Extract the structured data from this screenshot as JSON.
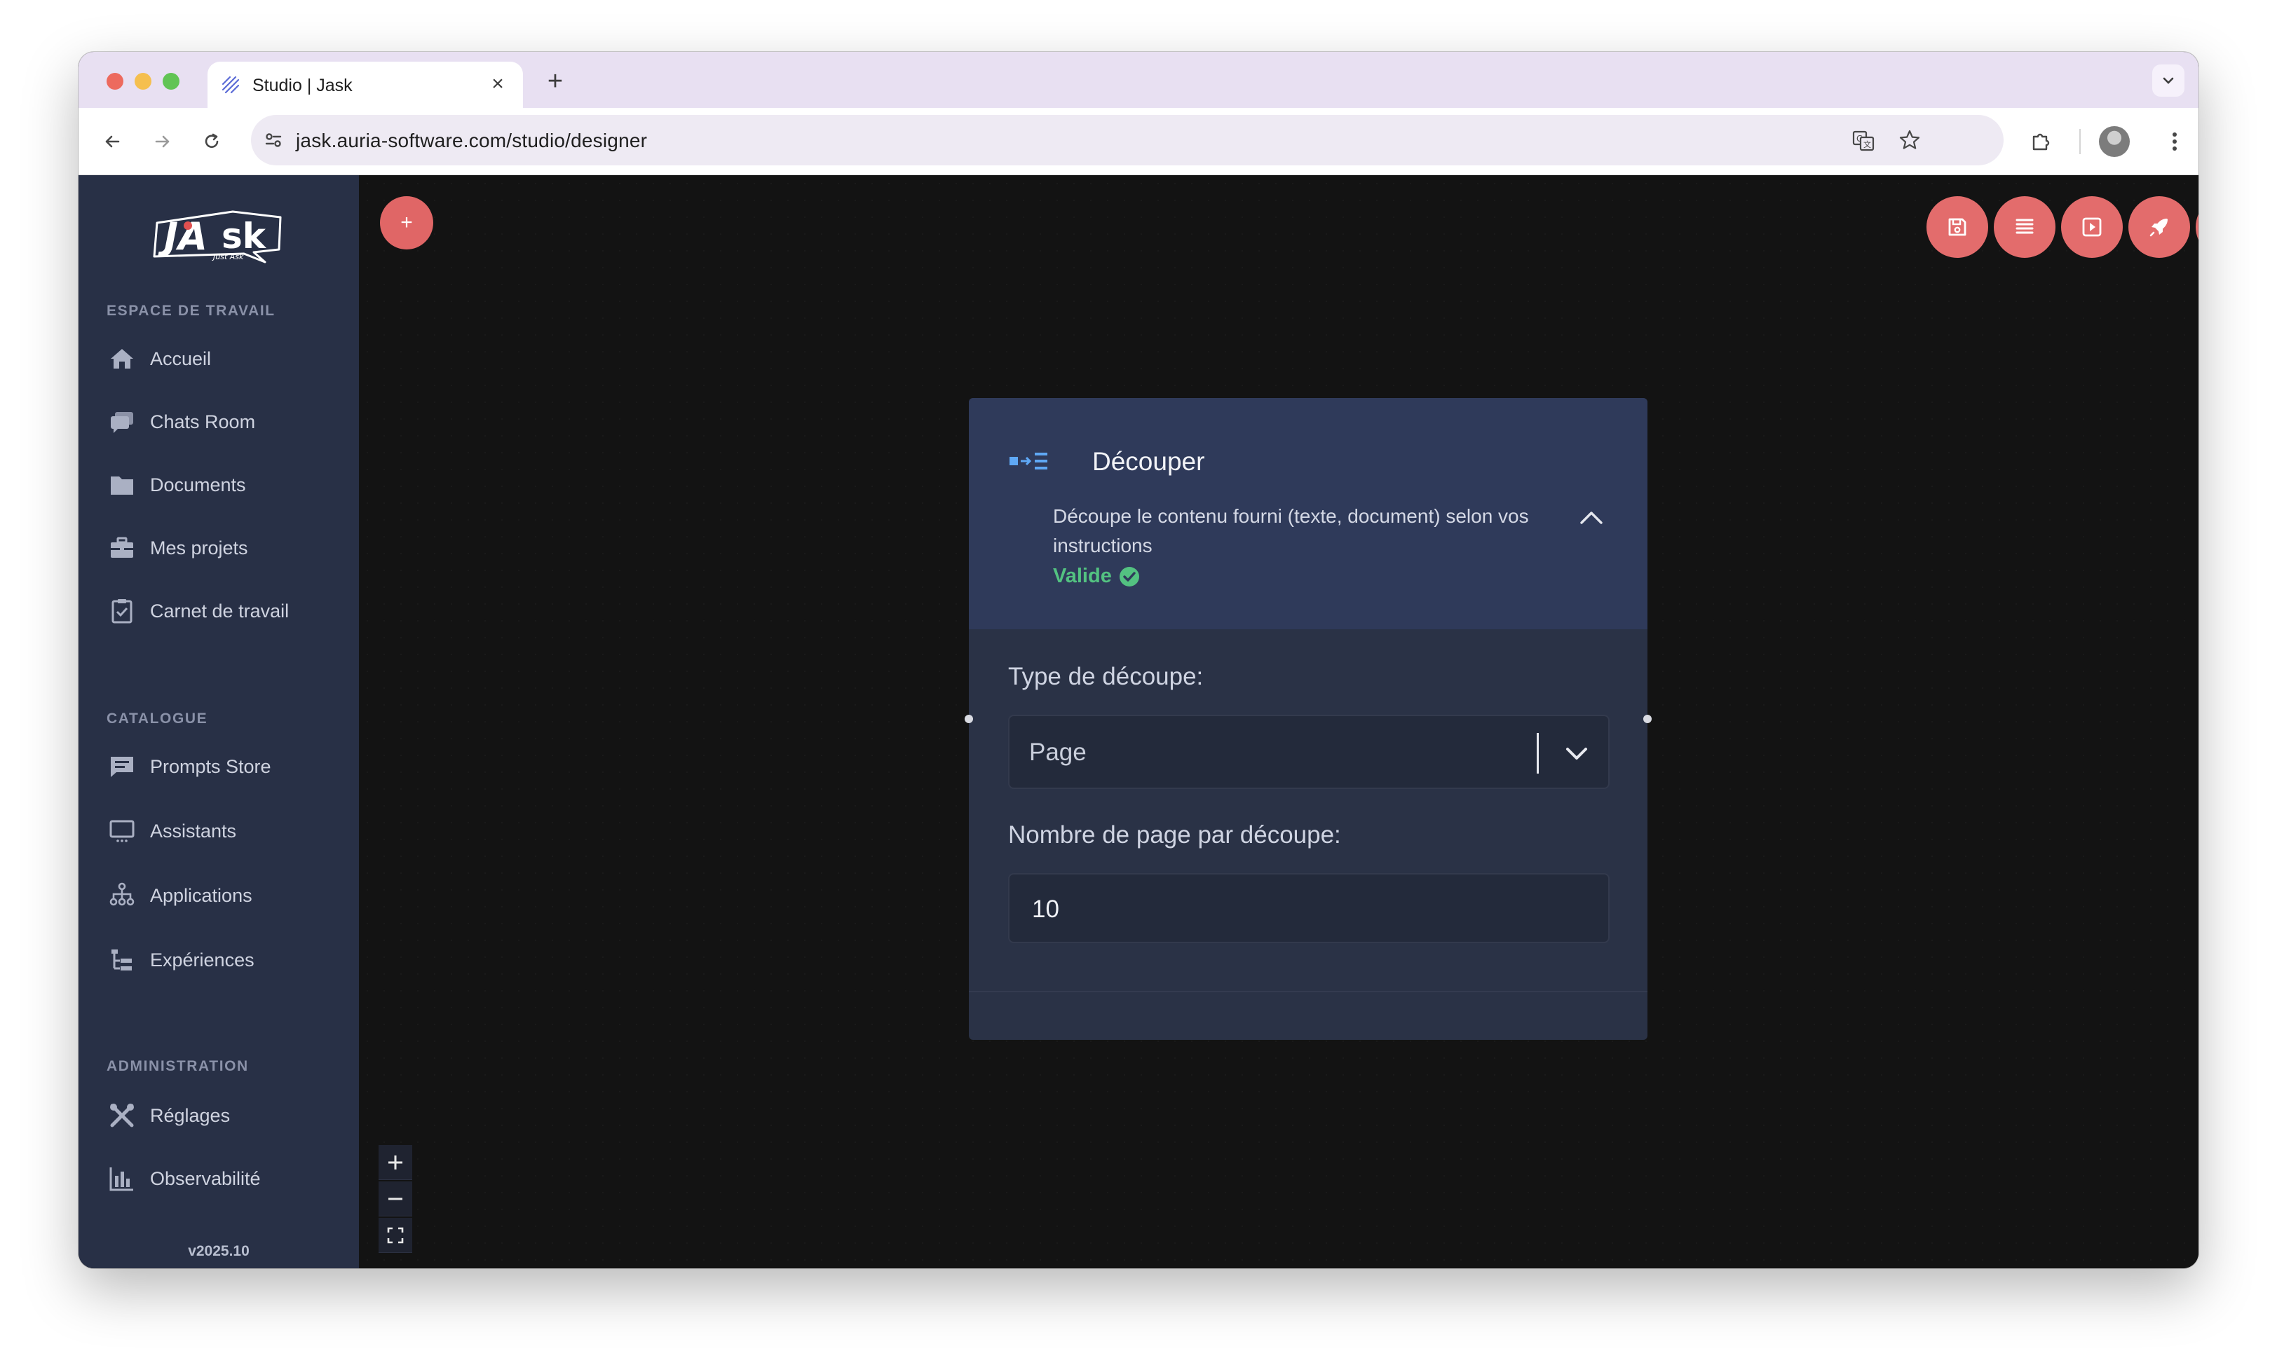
{
  "browser": {
    "tab_title": "Studio | Jask",
    "url": "jask.auria-software.com/studio/designer"
  },
  "sidebar": {
    "logo_text": "JAsk",
    "logo_tagline": "Just Ask",
    "sections": [
      {
        "label": "ESPACE DE TRAVAIL",
        "items": [
          {
            "label": "Accueil",
            "icon": "home-icon"
          },
          {
            "label": "Chats Room",
            "icon": "chat-icon"
          },
          {
            "label": "Documents",
            "icon": "folder-icon"
          },
          {
            "label": "Mes projets",
            "icon": "briefcase-icon"
          },
          {
            "label": "Carnet de travail",
            "icon": "clipboard-check-icon"
          }
        ]
      },
      {
        "label": "CATALOGUE",
        "items": [
          {
            "label": "Prompts Store",
            "icon": "message-icon"
          },
          {
            "label": "Assistants",
            "icon": "monitor-icon"
          },
          {
            "label": "Applications",
            "icon": "hierarchy-icon"
          },
          {
            "label": "Expériences",
            "icon": "tree-list-icon"
          }
        ]
      },
      {
        "label": "ADMINISTRATION",
        "items": [
          {
            "label": "Réglages",
            "icon": "tools-icon"
          },
          {
            "label": "Observabilité",
            "icon": "bar-chart-icon"
          }
        ]
      }
    ],
    "version": "v2025.10"
  },
  "canvas": {
    "add_button": "+",
    "actions": [
      "save-icon",
      "list-icon",
      "preview-icon",
      "rocket-icon",
      "play-icon"
    ],
    "zoom_controls": [
      "+",
      "−",
      "fit"
    ]
  },
  "node": {
    "title": "Découper",
    "description": "Découpe le contenu fourni (texte, document) selon vos instructions",
    "status": "Valide",
    "status_color": "#53c281",
    "fields": {
      "split_type_label": "Type de découpe:",
      "split_type_value": "Page",
      "pages_label": "Nombre de page par découpe:",
      "pages_value": "10"
    }
  },
  "colors": {
    "accent": "#e36c6c",
    "sidebar_bg": "#283046",
    "node_header_bg": "#2f3a5a"
  }
}
